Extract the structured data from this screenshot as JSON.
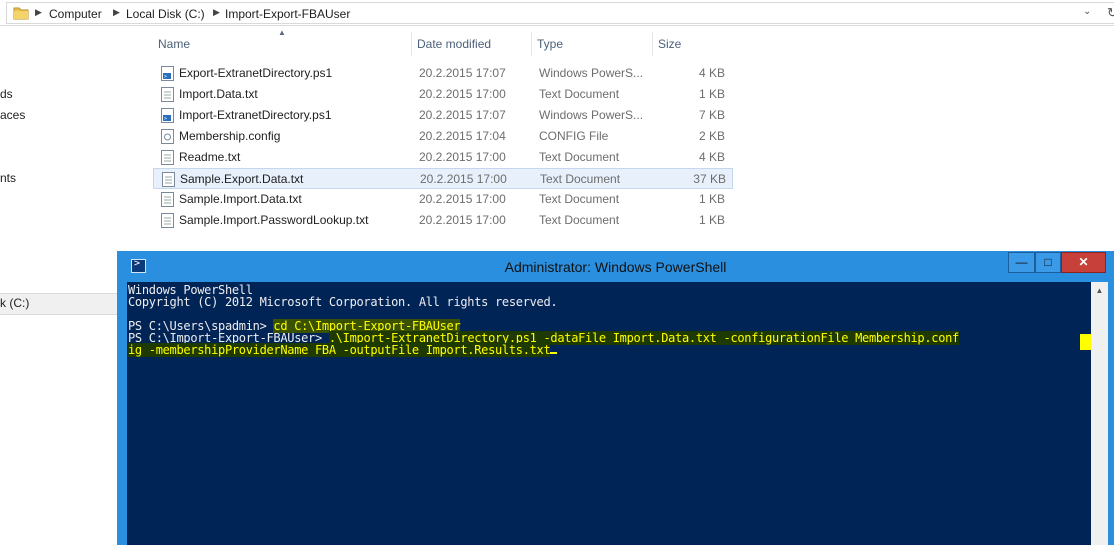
{
  "address": {
    "crumbs": [
      "Computer",
      "Local Disk (C:)",
      "Import-Export-FBAUser"
    ]
  },
  "nav_fragments": [
    "ds",
    "aces",
    "nts",
    "k (C:)"
  ],
  "columns": {
    "name": "Name",
    "date": "Date modified",
    "type": "Type",
    "size": "Size"
  },
  "files": [
    {
      "name": "Export-ExtranetDirectory.ps1",
      "date": "20.2.2015 17:07",
      "type": "Windows PowerS...",
      "size": "4 KB",
      "icon": "powershell-script-icon"
    },
    {
      "name": "Import.Data.txt",
      "date": "20.2.2015 17:00",
      "type": "Text Document",
      "size": "1 KB",
      "icon": "text-file-icon"
    },
    {
      "name": "Import-ExtranetDirectory.ps1",
      "date": "20.2.2015 17:07",
      "type": "Windows PowerS...",
      "size": "7 KB",
      "icon": "powershell-script-icon"
    },
    {
      "name": "Membership.config",
      "date": "20.2.2015 17:04",
      "type": "CONFIG File",
      "size": "2 KB",
      "icon": "config-file-icon"
    },
    {
      "name": "Readme.txt",
      "date": "20.2.2015 17:00",
      "type": "Text Document",
      "size": "4 KB",
      "icon": "text-file-icon"
    },
    {
      "name": "Sample.Export.Data.txt",
      "date": "20.2.2015 17:00",
      "type": "Text Document",
      "size": "37 KB",
      "icon": "text-file-icon"
    },
    {
      "name": "Sample.Import.Data.txt",
      "date": "20.2.2015 17:00",
      "type": "Text Document",
      "size": "1 KB",
      "icon": "text-file-icon"
    },
    {
      "name": "Sample.Import.PasswordLookup.txt",
      "date": "20.2.2015 17:00",
      "type": "Text Document",
      "size": "1 KB",
      "icon": "text-file-icon"
    }
  ],
  "powershell": {
    "title": "Administrator: Windows PowerShell",
    "banner1": "Windows PowerShell",
    "banner2": "Copyright (C) 2012 Microsoft Corporation. All rights reserved.",
    "prompt1": "PS C:\\Users\\spadmin> ",
    "cmd1": "cd C:\\Import-Export-FBAUser",
    "prompt2": "PS C:\\Import-Export-FBAUser> ",
    "cmd2a": ".\\Import-ExtranetDirectory.ps1 -dataFile Import.Data.txt -configurationFile Membership.conf",
    "cmd2b": "ig -membershipProviderName FBA -outputFile Import.Results.txt"
  },
  "colors": {
    "console_bg": "#012456",
    "console_text": "#eeedf0",
    "highlight_text": "#ffff00",
    "titlebar": "#2b8fe0",
    "close_button": "#c7413a"
  }
}
